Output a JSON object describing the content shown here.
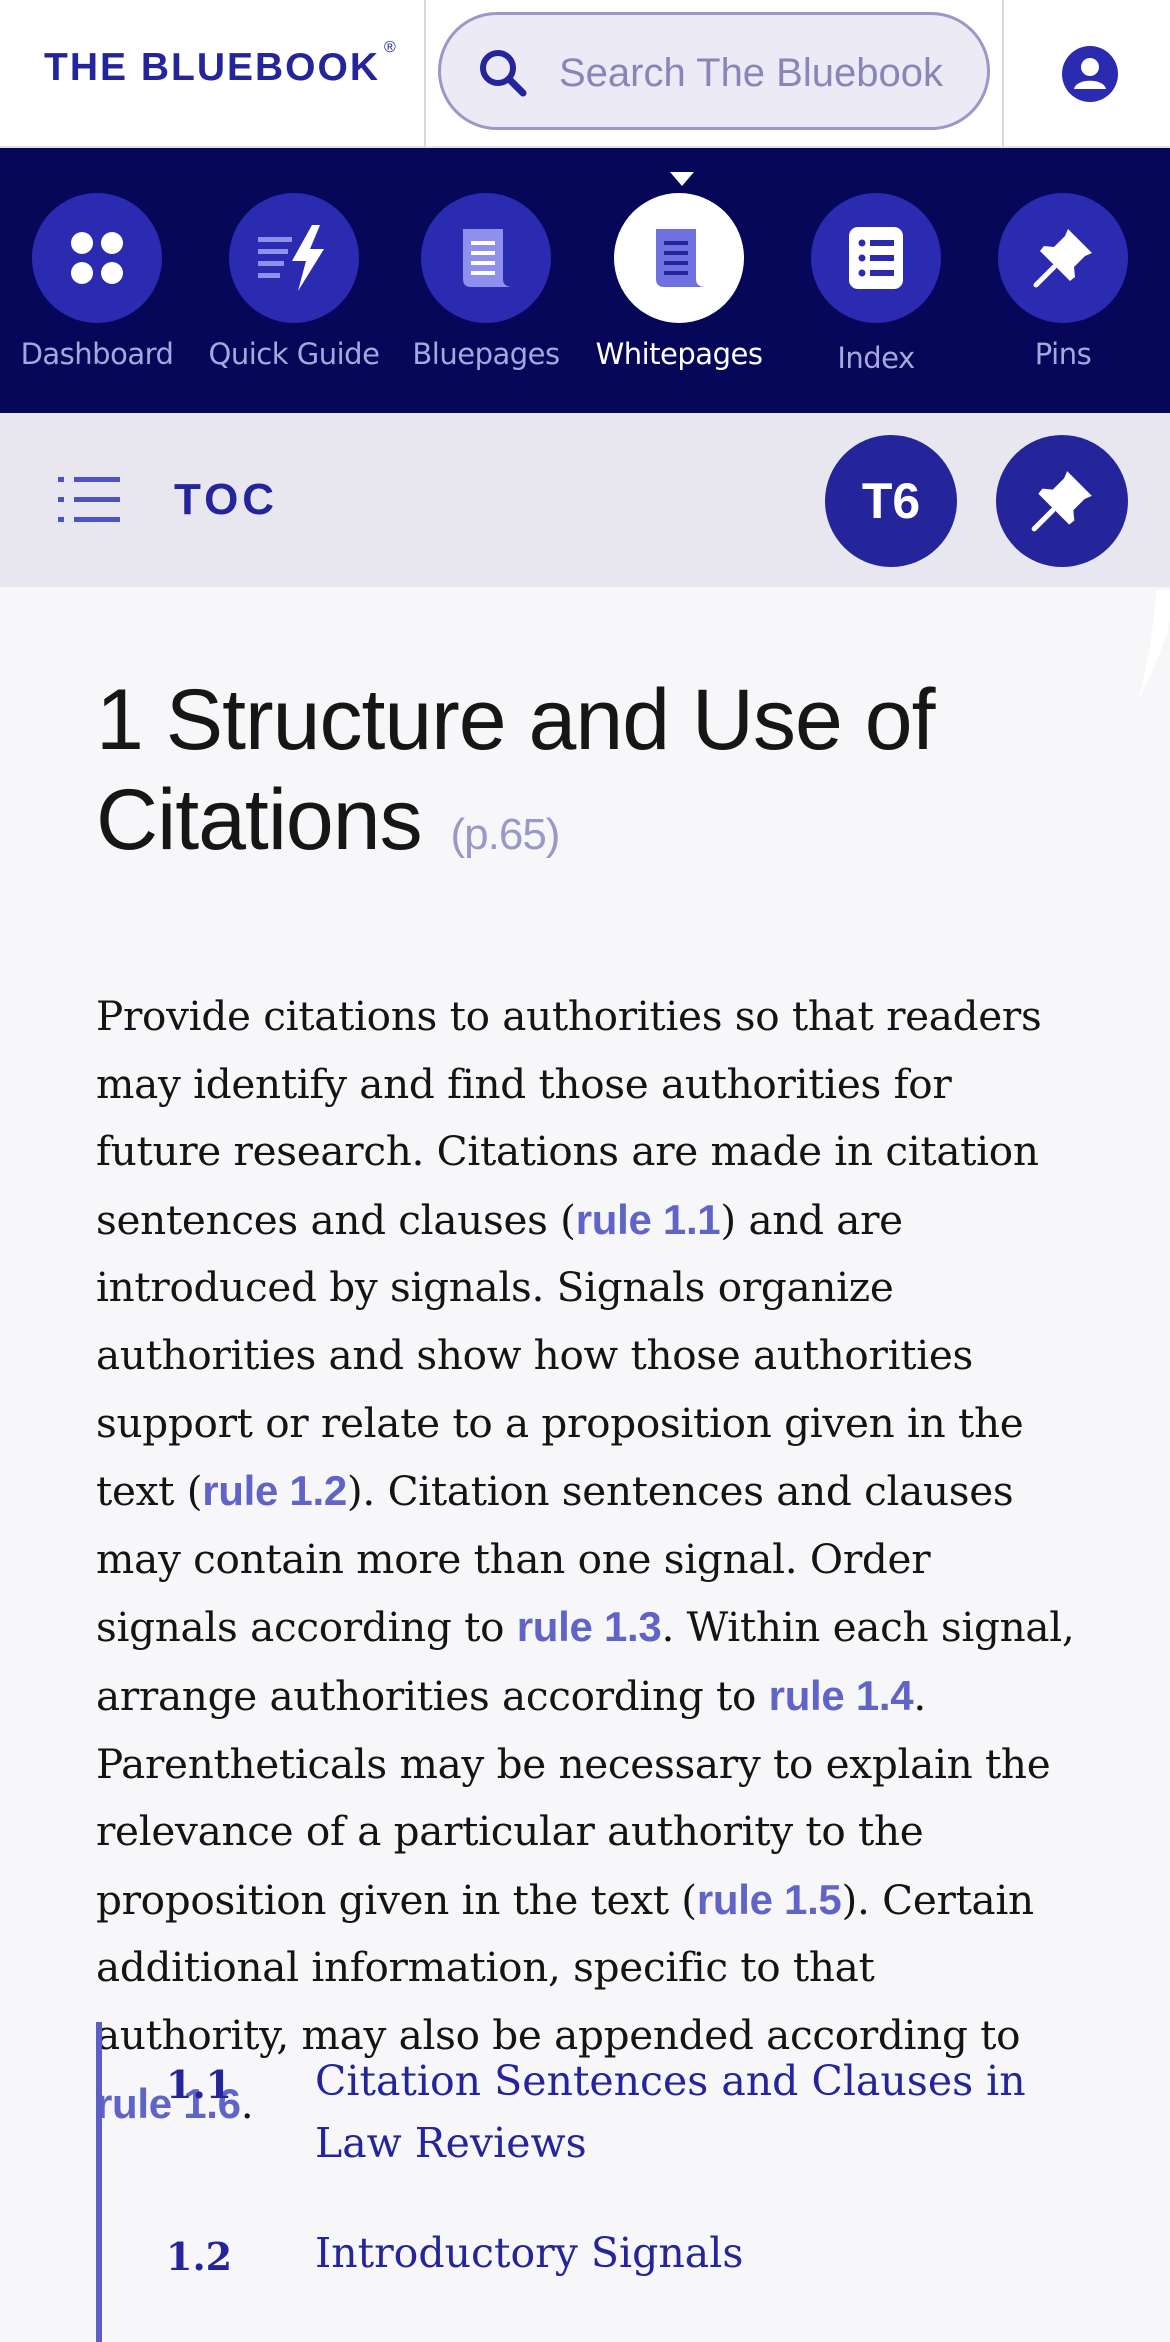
{
  "header": {
    "logo": "THE BLUEBOOK",
    "logo_mark": "®",
    "search_placeholder": "Search The Bluebook",
    "search_icon": "search-icon",
    "user_icon": "user-icon"
  },
  "nav": {
    "items": [
      {
        "label": "Dashboard",
        "icon": "dashboard-icon"
      },
      {
        "label": "Quick Guide",
        "icon": "quick-guide-icon"
      },
      {
        "label": "Bluepages",
        "icon": "bluepages-icon"
      },
      {
        "label": "Whitepages",
        "icon": "whitepages-icon",
        "active": true
      },
      {
        "label": "Index",
        "icon": "index-icon"
      },
      {
        "label": "Pins",
        "icon": "pin-icon"
      }
    ]
  },
  "toc_bar": {
    "label": "TOC",
    "table_button": "T6",
    "pin_icon": "pin-icon"
  },
  "article": {
    "title": "1 Structure and Use of Citations",
    "page_ref": "(p.65)",
    "segments": [
      "Provide citations to authorities so that readers may identify and find those authorities for future research. Citations are made in citation sentences and clauses (",
      "rule 1.1",
      ") and are introduced by signals. Signals organize authorities and show how those authorities support or relate to a proposition given in the text (",
      "rule 1.2",
      "). Citation sentences and clauses may contain more than one signal. Order signals according to ",
      "rule 1.3",
      ". Within each signal, arrange authorities according to ",
      "rule 1.4",
      ". Parentheticals may be necessary to explain the relevance of a particular authority to the proposition given in the text (",
      "rule 1.5",
      "). Certain additional information, specific to that authority, may also be appended according to ",
      "rule 1.6",
      "."
    ]
  },
  "subrules": [
    {
      "number": "1.1",
      "title": "Citation Sentences and Clauses in Law Reviews"
    },
    {
      "number": "1.2",
      "title": "Introductory Signals"
    }
  ],
  "colors": {
    "brand": "#24259a",
    "nav_bg": "#07075a",
    "link": "#5f64c6"
  }
}
